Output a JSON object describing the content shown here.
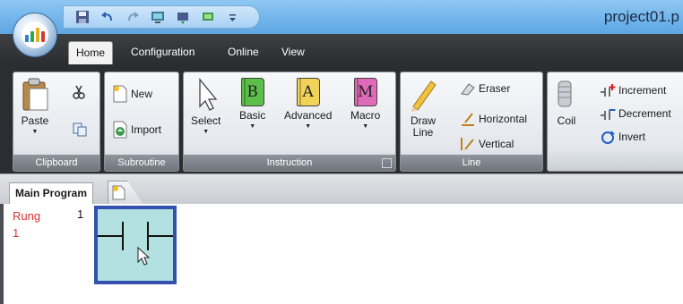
{
  "window": {
    "title": "project01.p"
  },
  "quick_access": {
    "items": [
      "save-icon",
      "undo-icon",
      "redo-icon",
      "monitor-icon",
      "transfer-icon",
      "compile-icon",
      "customize-icon"
    ]
  },
  "tabs": [
    {
      "label": "Home",
      "active": true
    },
    {
      "label": "Configuration",
      "active": false
    },
    {
      "label": "Online",
      "active": false
    },
    {
      "label": "View",
      "active": false
    }
  ],
  "ribbon": {
    "clipboard": {
      "label": "Clipboard",
      "paste": "Paste"
    },
    "subroutine": {
      "label": "Subroutine",
      "new": "New",
      "import": "Import"
    },
    "instruction": {
      "label": "Instruction",
      "select": "Select",
      "basic": "Basic",
      "advanced": "Advanced",
      "macro": "Macro"
    },
    "line": {
      "label": "Line",
      "draw": "Draw\nLine",
      "eraser": "Eraser",
      "horizontal": "Horizontal",
      "vertical": "Vertical"
    },
    "coil_group": {
      "coil": "Coil",
      "increment": "Increment",
      "decrement": "Decrement",
      "invert": "Invert"
    }
  },
  "book_letters": {
    "basic": "B",
    "advanced": "A",
    "macro": "M"
  },
  "document": {
    "tab": "Main Program",
    "rung_label": "Rung\n1",
    "rung_number": "1"
  },
  "colors": {
    "rung_label": "#e03030",
    "cell_border": "#3451b0",
    "cell_fill": "#b3e0e0",
    "basic_book": "#5cbf4a",
    "advanced_book": "#f2d35a",
    "macro_book": "#e06ab8"
  }
}
